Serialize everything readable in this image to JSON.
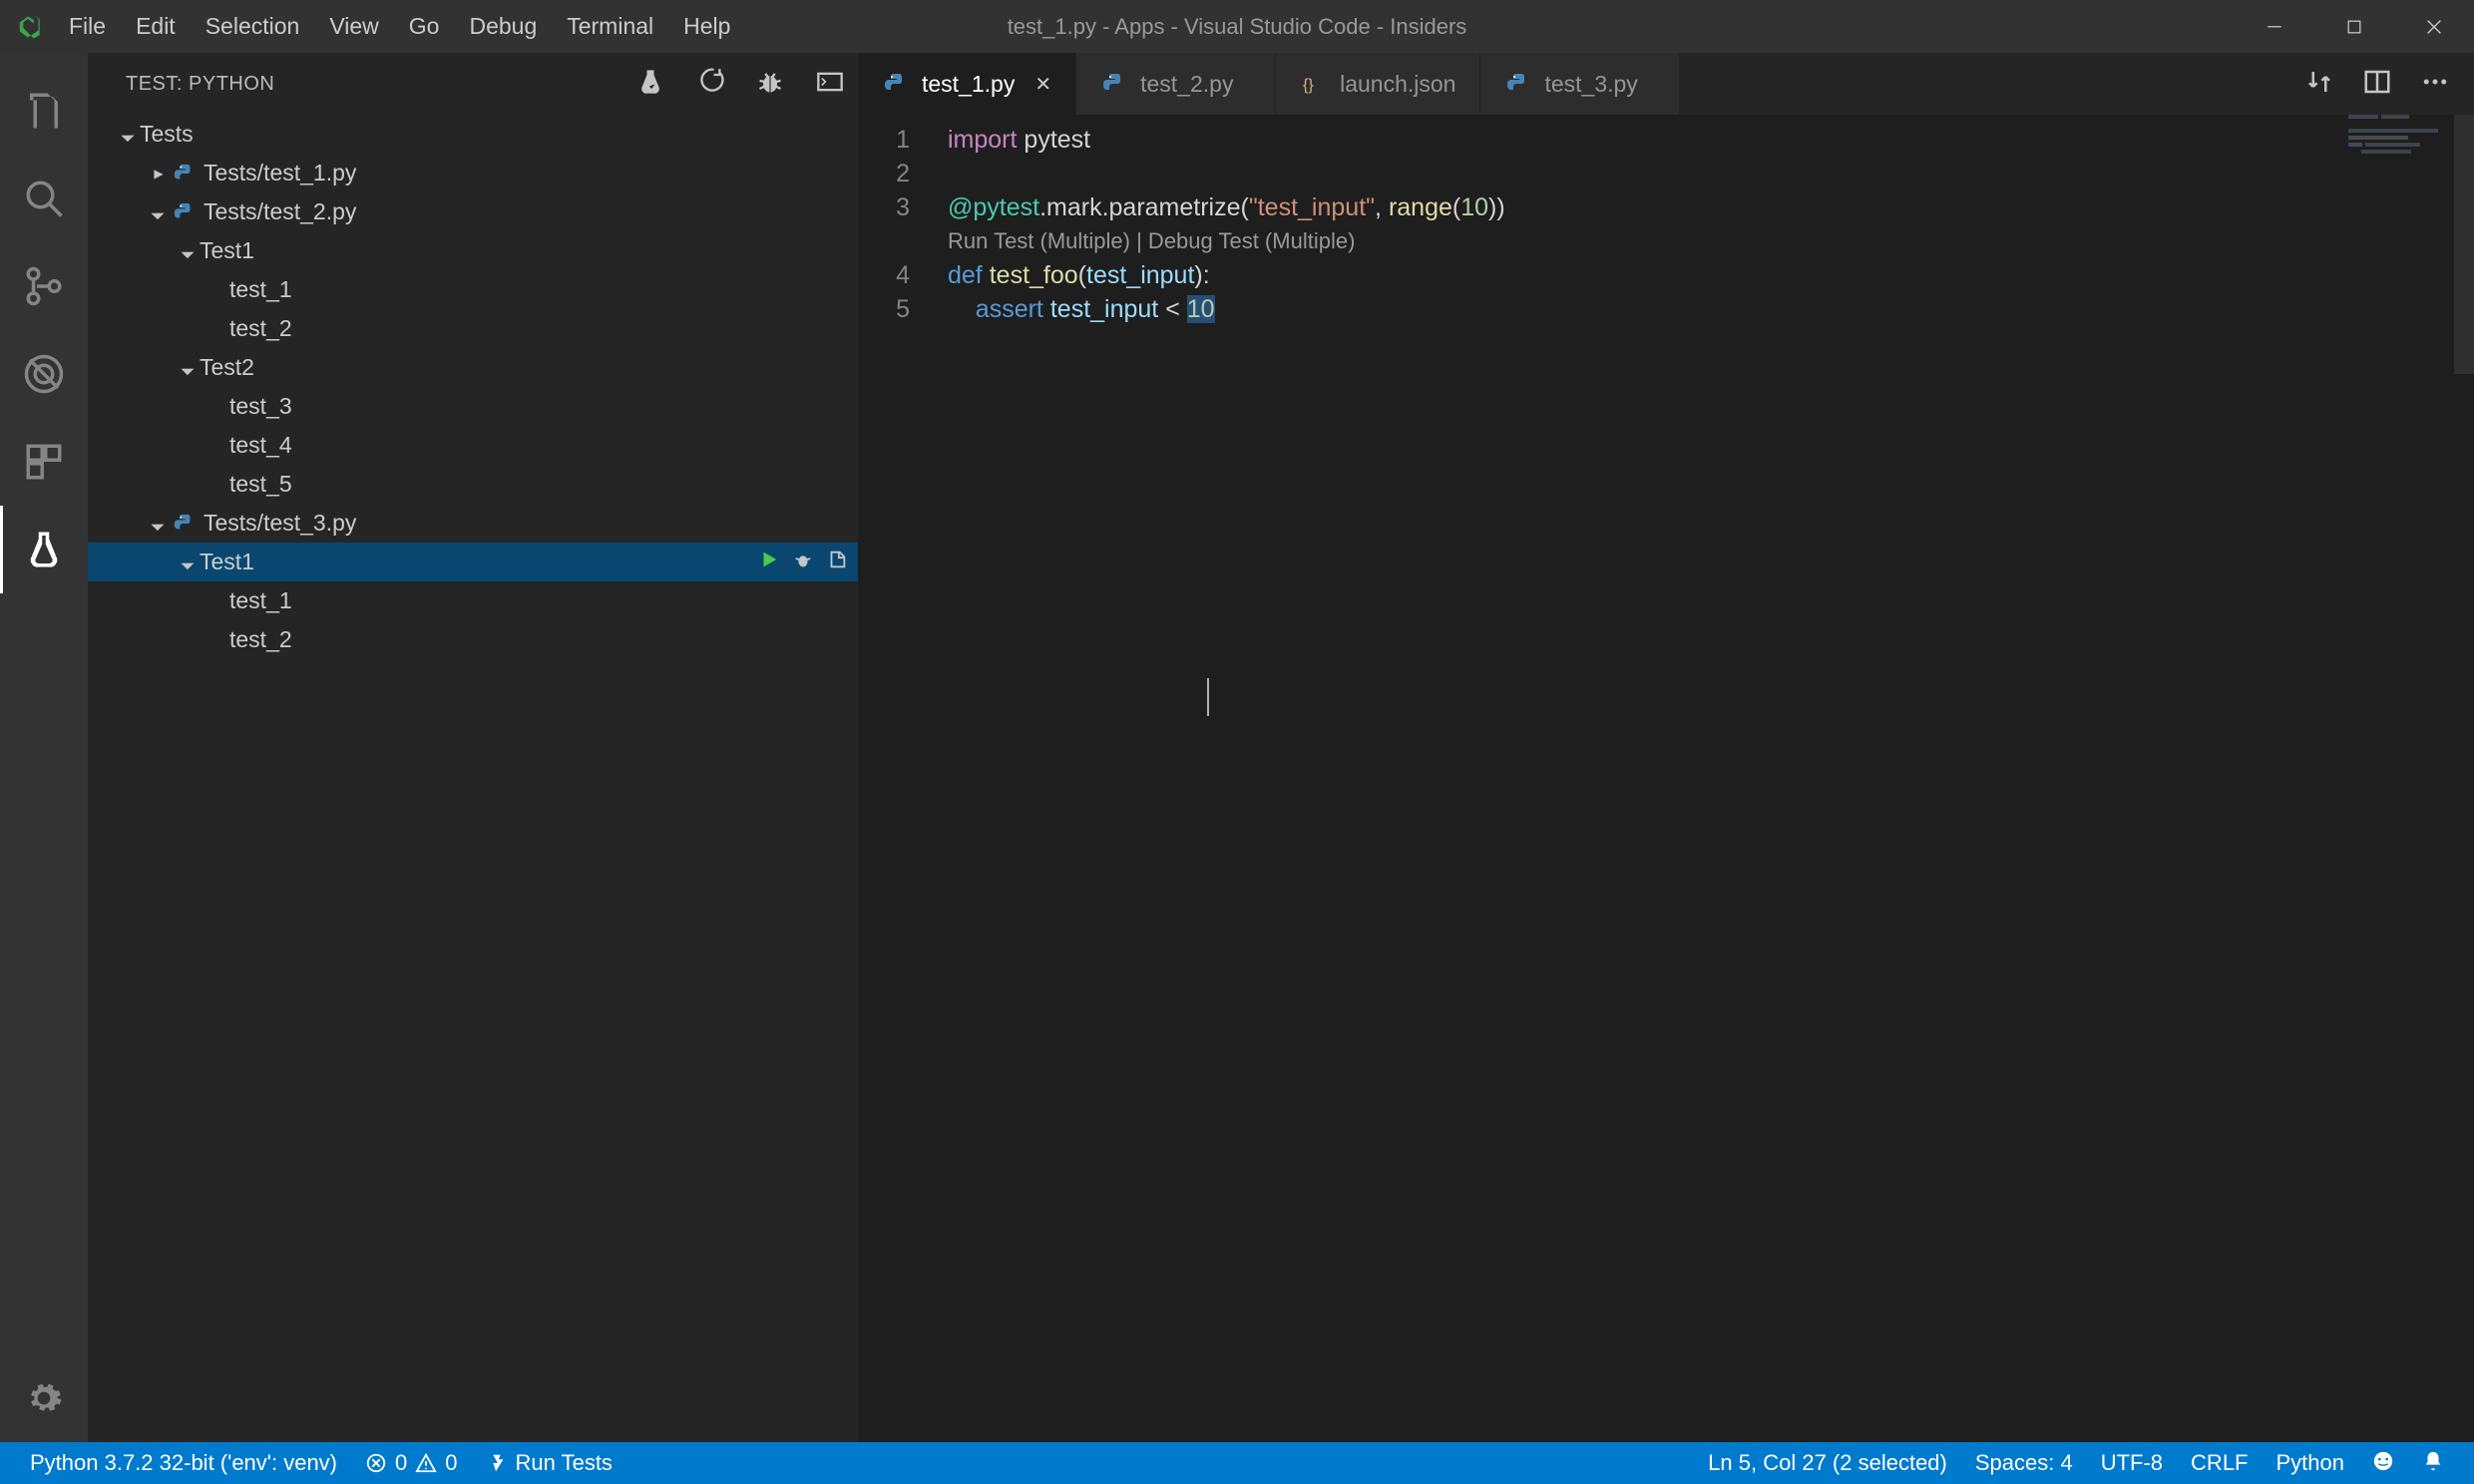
{
  "menubar": [
    "File",
    "Edit",
    "Selection",
    "View",
    "Go",
    "Debug",
    "Terminal",
    "Help"
  ],
  "window_title": "test_1.py - Apps - Visual Studio Code - Insiders",
  "sidebar": {
    "title": "TEST: PYTHON",
    "tree": {
      "root": "Tests",
      "file1": "Tests/test_1.py",
      "file2": "Tests/test_2.py",
      "file2_class1": "Test1",
      "file2_class1_t1": "test_1",
      "file2_class1_t2": "test_2",
      "file2_class2": "Test2",
      "file2_class2_t3": "test_3",
      "file2_class2_t4": "test_4",
      "file2_class2_t5": "test_5",
      "file3": "Tests/test_3.py",
      "file3_class1": "Test1",
      "file3_class1_t1": "test_1",
      "file3_class1_t2": "test_2"
    }
  },
  "tabs": {
    "t1": "test_1.py",
    "t2": "test_2.py",
    "t3": "launch.json",
    "t4": "test_3.py"
  },
  "editor": {
    "line1_kw": "import",
    "line1_mod": " pytest",
    "line3_dec1": "@pytest",
    "line3_dec2": ".mark.parametrize",
    "line3_open": "(",
    "line3_str": "\"test_input\"",
    "line3_mid": ", ",
    "line3_fn": "range",
    "line3_open2": "(",
    "line3_num": "10",
    "line3_close": "))",
    "codelens": "Run Test (Multiple) | Debug Test (Multiple)",
    "line4_def": "def",
    "line4_sp": " ",
    "line4_fn": "test_foo",
    "line4_p1": "(",
    "line4_param": "test_input",
    "line4_p2": "):",
    "line5_indent": "    ",
    "line5_kw": "assert",
    "line5_sp": " ",
    "line5_var": "test_input",
    "line5_op": " < ",
    "line5_num": "10"
  },
  "status": {
    "python": "Python 3.7.2 32-bit ('env': venv)",
    "errors": "0",
    "warnings": "0",
    "runtests": "Run Tests",
    "cursor": "Ln 5, Col 27 (2 selected)",
    "spaces": "Spaces: 4",
    "encoding": "UTF-8",
    "eol": "CRLF",
    "lang": "Python"
  }
}
